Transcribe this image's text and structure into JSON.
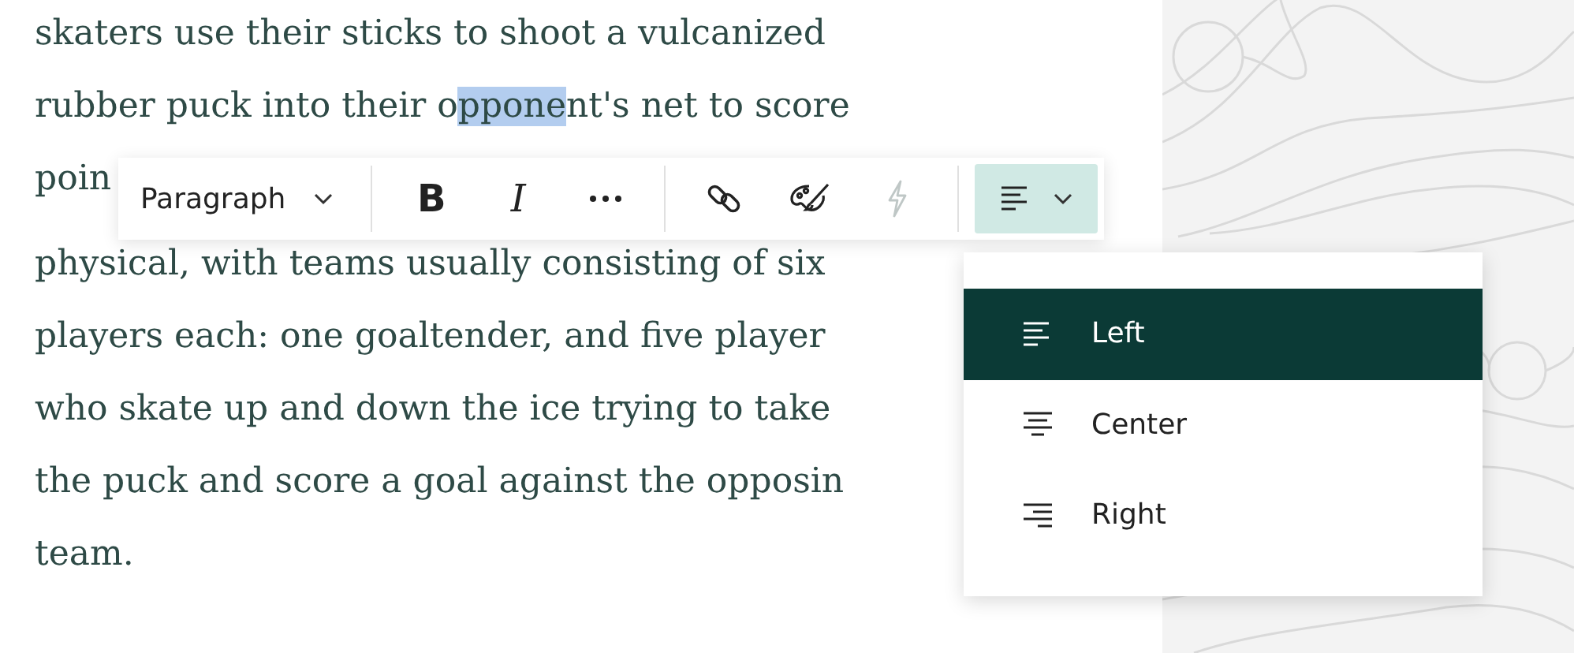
{
  "paragraph_lines": [
    {
      "segments": [
        {
          "text": "skaters use their sticks to shoot a vulcanized",
          "selected": false
        }
      ]
    },
    {
      "segments": [
        {
          "text": "rubber puck into their o",
          "selected": false
        },
        {
          "text": "ppone",
          "selected": true
        },
        {
          "text": "nt's net to score",
          "selected": false
        }
      ]
    },
    {
      "segments": [
        {
          "text": "poin",
          "selected": false
        }
      ]
    },
    {
      "segments": [
        {
          "text": "physical, with teams usually consisting of six",
          "selected": false
        }
      ]
    },
    {
      "segments": [
        {
          "text": "players each: one goaltender, and five player",
          "selected": false
        }
      ]
    },
    {
      "segments": [
        {
          "text": "who skate up and down the ice trying to take",
          "selected": false
        }
      ]
    },
    {
      "segments": [
        {
          "text": "the puck and score a goal against the opposin",
          "selected": false
        }
      ]
    },
    {
      "segments": [
        {
          "text": "team.",
          "selected": false
        }
      ]
    }
  ],
  "toolbar": {
    "block_style": "Paragraph",
    "tools": [
      {
        "kind": "bold",
        "label": "B",
        "disabled": false
      },
      {
        "kind": "italic",
        "label": "I",
        "disabled": false
      },
      {
        "kind": "more",
        "disabled": false
      },
      {
        "kind": "link",
        "disabled": false
      },
      {
        "kind": "palette",
        "disabled": false
      },
      {
        "kind": "lightning",
        "disabled": true
      }
    ],
    "align_button": {
      "expanded": true
    }
  },
  "align_menu": [
    {
      "kind": "left",
      "label": "Left",
      "selected": true
    },
    {
      "kind": "center",
      "label": "Center",
      "selected": false
    },
    {
      "kind": "right",
      "label": "Right",
      "selected": false
    }
  ]
}
